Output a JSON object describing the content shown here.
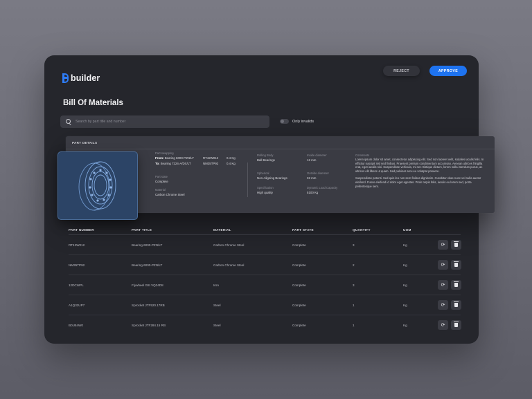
{
  "brand": {
    "name": "builder",
    "accent": "#1e73f0"
  },
  "header": {
    "reject_label": "REJECT",
    "approve_label": "APPROVE"
  },
  "page": {
    "title": "Bill Of Materials"
  },
  "search": {
    "placeholder": "Search by part title and number",
    "value": ""
  },
  "filter": {
    "only_invalids_label": "Only invalids",
    "only_invalids_on": false
  },
  "details": {
    "header": "PART DETAILS",
    "part_swapping_label": "Part swapping",
    "from_prefix": "From:",
    "from_title": "Bearing  6000-PZN/LT",
    "from_number": "RT42W012",
    "from_weight": "0.4 Kg",
    "to_prefix": "To:",
    "to_title": "Bearing  7224-A/DX/LT",
    "to_number": "NM35TP92",
    "to_weight": "0.4 Kg",
    "part_state_label": "Part state",
    "part_state_value": "Complete",
    "material_label": "Material",
    "material_value": "Carbon Chrome Steel",
    "rolling_body_label": "Rolling Body",
    "rolling_body_value": "Ball Bearings",
    "spherical_label": "Spherical",
    "spherical_value": "Non-Aligning Bearings",
    "specification_label": "Specification",
    "specification_value": "High quality",
    "inside_diameter_label": "Inside diameter",
    "inside_diameter_value": "12 mm",
    "outside_diameter_label": "Outside diameter",
    "outside_diameter_value": "32 mm",
    "dynamic_load_label": "Dynamic Load Capacity",
    "dynamic_load_value": "5100 Kg",
    "comments_label": "Comments",
    "comment_1": "Lorem ipsum dolor sit amet, consectetur adipiscing elit. Sed non laoreet velit, sodales iaculis felis. In efficitur suscipit nisl sed finibus. Praesent pretium condimentum accumsan. Aenean ultrices fringilla erat, eget iaculis nisi. Suspendisse vehicula, mi nec tristique dictum, lorem nulla interdum purus, ac ultrices elit libero ut quam. Sed pulvinar arcu eu volutpat posuere.",
    "comment_2": "Suspendisse potenti. Sed quis leo non sem finibus dignissim. Curabitur vitae nunc vel nulla auctor eleifend. Fusce eleifend id dolor eget egestas. Proin turpis felis, iaculis eu lorem sed, porta pellentesque sem."
  },
  "table": {
    "headers": [
      "PART NUMBER",
      "PART TITLE",
      "MATERIAL",
      "PART STATE",
      "QUANTITY",
      "UOM"
    ],
    "rows": [
      [
        "RT42W012",
        "Bearing  6000-PZN/LT",
        "Carbon Chrome Steel",
        "Complete",
        "3",
        "Kg"
      ],
      [
        "NM35TP92",
        "Bearing  6000-PZN/LT",
        "Carbon Chrome Steel",
        "Complete",
        "2",
        "Kg"
      ],
      [
        "12DCWPL",
        "Flywheel G8I VQ34D8",
        "Iron",
        "Complete",
        "3",
        "Kg"
      ],
      [
        "A1Q32UP7",
        "Sprocket JTF520.17RB",
        "Steel",
        "Complete",
        "1",
        "Kg"
      ],
      [
        "B0U54W0",
        "Sprocket JTF284.15 RB",
        "Steel",
        "Complete",
        "1",
        "Kg"
      ]
    ]
  }
}
